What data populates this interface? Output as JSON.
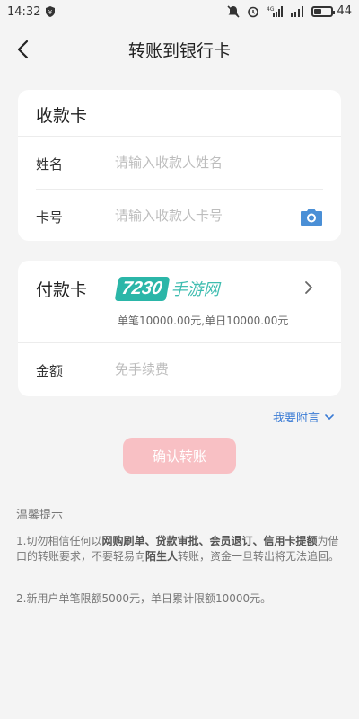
{
  "status_bar": {
    "time": "14:32",
    "network": "4G",
    "battery_text": "44",
    "battery_level": 0.44
  },
  "nav": {
    "title": "转账到银行卡"
  },
  "payee_card": {
    "title": "收款卡",
    "name_label": "姓名",
    "name_placeholder": "请输入收款人姓名",
    "number_label": "卡号",
    "number_placeholder": "请输入收款人卡号"
  },
  "payer_card": {
    "title": "付款卡",
    "limit_text": "单笔10000.00元,单日10000.00元",
    "amount_label": "金额",
    "amount_placeholder": "免手续费",
    "watermark_logo": "7230",
    "watermark_text": "手游网"
  },
  "remark_link": "我要附言",
  "confirm_button": "确认转账",
  "tips": {
    "title": "温馨提示",
    "p1_parts": [
      "1.切勿相信任何以",
      "网购刷单、贷款审批、会员退订、信用卡提额",
      "为借口的转账要求，不要轻易向",
      "陌生人",
      "转账，资金一旦转出将无法追回。"
    ],
    "p2": "2.新用户单笔限额5000元，单日累计限额10000元。"
  },
  "colors": {
    "accent": "#3a7bd5",
    "button_disabled": "#f8c0c4",
    "background": "#f4f4f4",
    "watermark": "#2bb6a8"
  }
}
